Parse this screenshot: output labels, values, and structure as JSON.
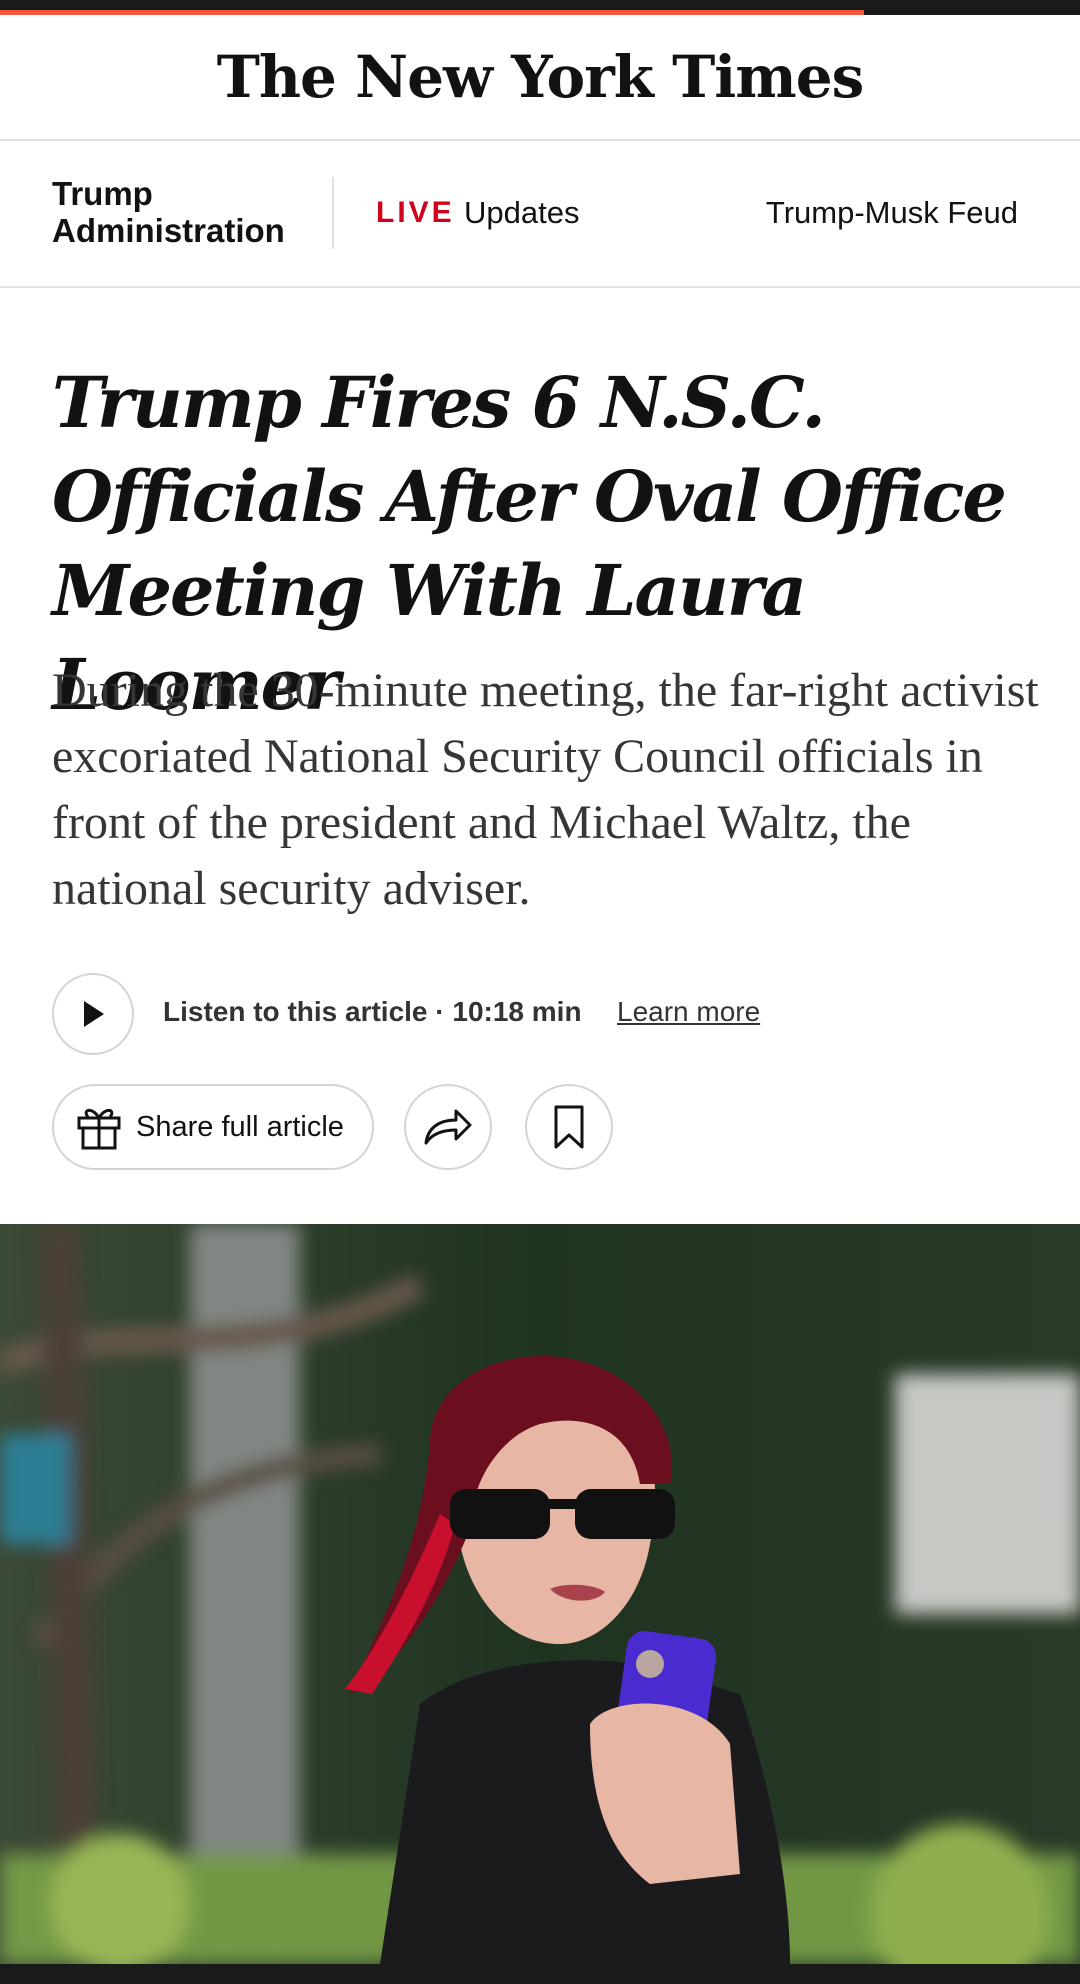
{
  "reading_progress": 0.8,
  "masthead": {
    "logo_text": "The New York Times"
  },
  "subnav": {
    "section_title": "Trump Administration",
    "live_badge": "LIVE",
    "live_link": "Updates",
    "topic_link": "Trump-Musk Feud"
  },
  "article": {
    "headline": "Trump Fires 6 N.S.C. Officials After Oval Office Meeting With Laura Loomer",
    "summary": "During the 30-minute meeting, the far-right activist excoriated National Security Council officials in front of the president and Michael Waltz, the national security adviser."
  },
  "audio": {
    "listen_label": "Listen to this article · 10:18 min",
    "learn_more": "Learn more",
    "play_icon": "play-icon"
  },
  "actions": {
    "share_full_label": "Share full article",
    "gift_icon": "gift-icon",
    "share_icon": "share-arrow-icon",
    "save_icon": "bookmark-icon"
  },
  "colors": {
    "accent_progress": "#ef5a3c",
    "live_red": "#d0021b",
    "text": "#121212"
  }
}
